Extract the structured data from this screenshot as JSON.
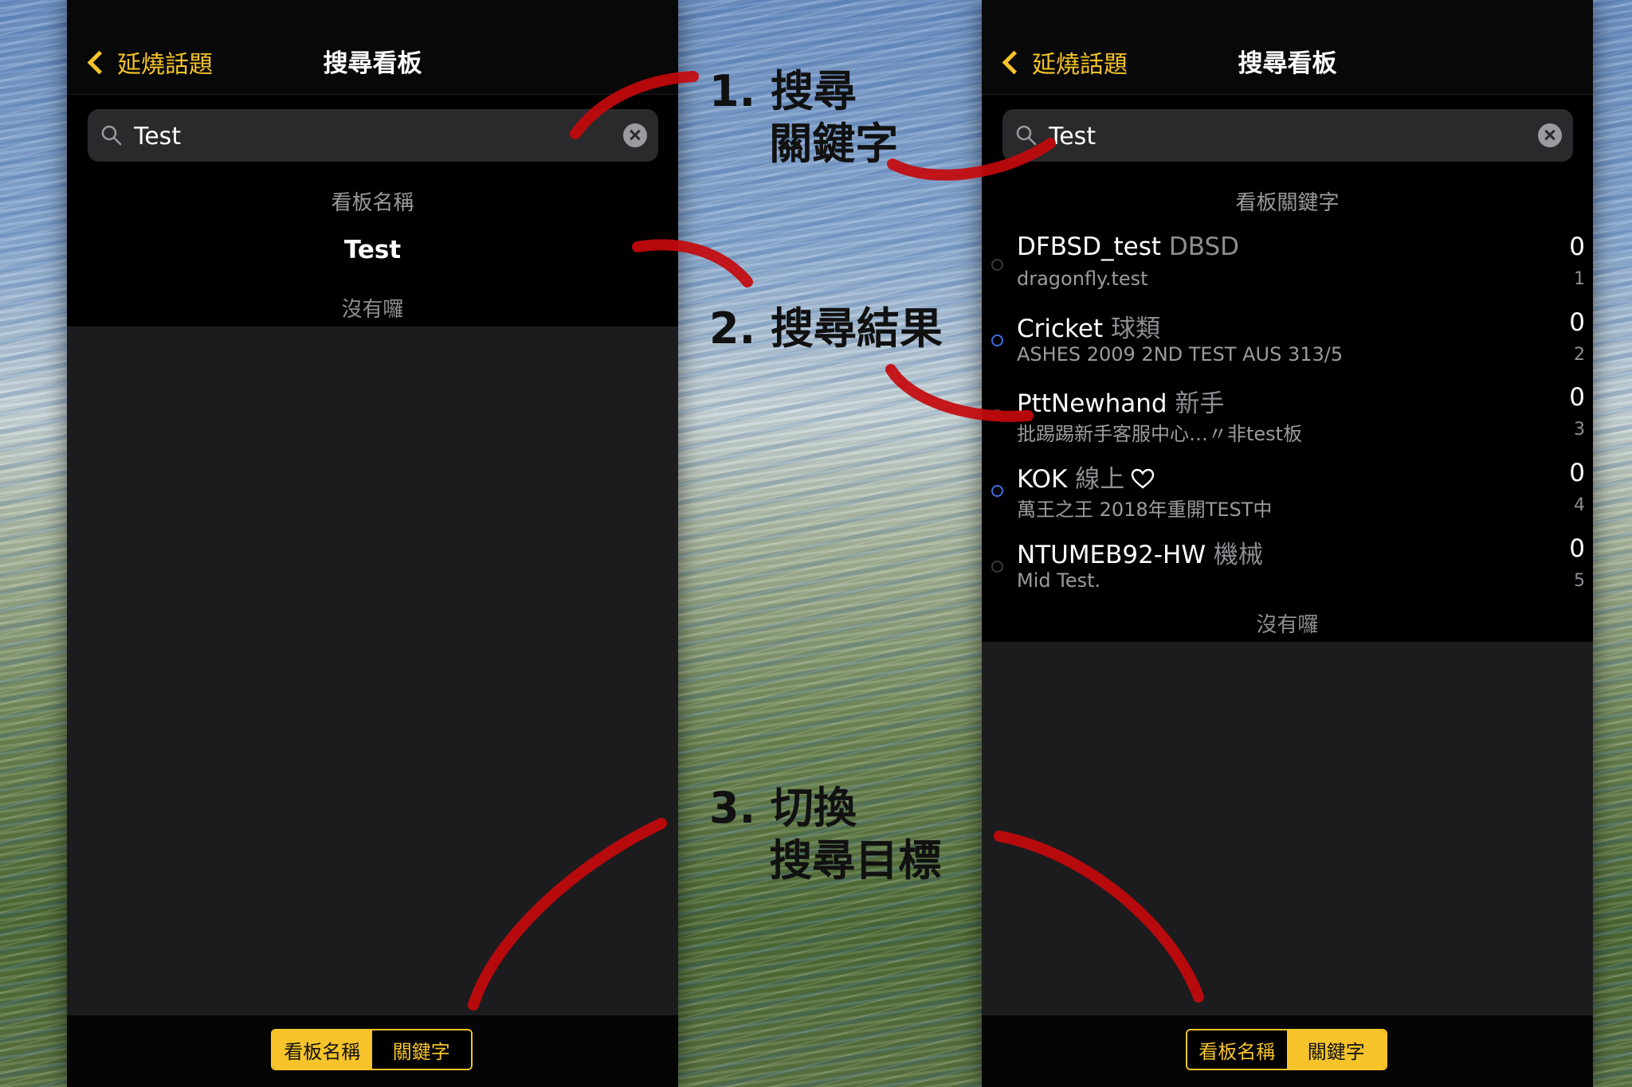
{
  "colors": {
    "accent": "#f6c42a",
    "unread_dot": "#3b6fe0",
    "annotation_stroke": "#c4090c"
  },
  "left_screen": {
    "nav": {
      "back_label": "延燒話題",
      "title": "搜尋看板"
    },
    "search": {
      "value": "Test",
      "placeholder": ""
    },
    "section_header": "看板名稱",
    "result_name": "Test",
    "empty_text": "沒有囉",
    "segmented": {
      "option_board_name": "看板名稱",
      "option_keyword": "關鍵字",
      "selected": "看板名稱"
    }
  },
  "right_screen": {
    "nav": {
      "back_label": "延燒話題",
      "title": "搜尋看板"
    },
    "search": {
      "value": "Test",
      "placeholder": ""
    },
    "section_header": "看板關鍵字",
    "boards": [
      {
        "name": "DFBSD_test",
        "category": "DBSD",
        "description": "dragonfly.test",
        "count": "0",
        "index": "1",
        "unread": false,
        "icon": ""
      },
      {
        "name": "Cricket",
        "category": "球類",
        "description": "ASHES 2009 2ND TEST AUS 313/5",
        "count": "0",
        "index": "2",
        "unread": true,
        "icon": ""
      },
      {
        "name": "PttNewhand",
        "category": "新手",
        "description": "批踢踢新手客服中心…〃非test板",
        "count": "0",
        "index": "3",
        "unread": false,
        "icon": ""
      },
      {
        "name": "KOK",
        "category": "線上",
        "description": "萬王之王 2018年重開TEST中",
        "count": "0",
        "index": "4",
        "unread": true,
        "icon": "heart-outline-icon"
      },
      {
        "name": "NTUMEB92-HW",
        "category": "機械",
        "description": "Mid Test.",
        "count": "0",
        "index": "5",
        "unread": false,
        "icon": ""
      }
    ],
    "empty_text": "沒有囉",
    "segmented": {
      "option_board_name": "看板名稱",
      "option_keyword": "關鍵字",
      "selected": "關鍵字"
    }
  },
  "annotations": {
    "step1": "1. 搜尋\n    關鍵字",
    "step2": "2. 搜尋結果",
    "step3": "3. 切換\n    搜尋目標"
  }
}
